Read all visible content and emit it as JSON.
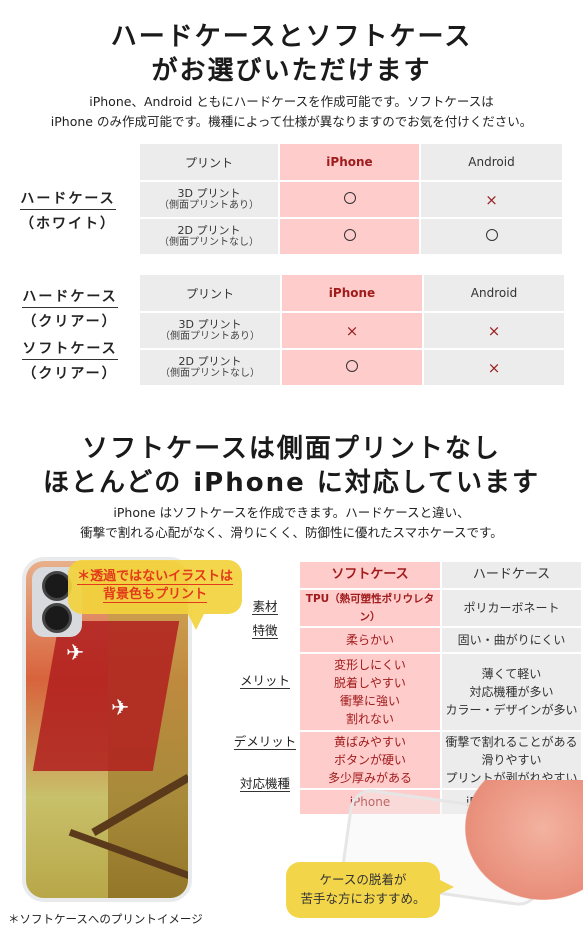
{
  "section1": {
    "title_line1": "ハードケースとソフトケース",
    "title_line2": "がお選びいただけます",
    "sub_line1": "iPhone、Android ともにハードケースを作成可能です。ソフトケースは",
    "sub_line2": "iPhone のみ作成可能です。機種によって仕様が異なりますのでお気を付けください。"
  },
  "table1": {
    "label_main": "ハードケース",
    "label_paren": "（ホワイト）",
    "headers": [
      "プリント",
      "iPhone",
      "Android"
    ],
    "rows": [
      {
        "print": "3D プリント",
        "print_note": "（側面プリントあり）",
        "iphone": "circle",
        "android": "cross"
      },
      {
        "print": "2D プリント",
        "print_note": "（側面プリントなし）",
        "iphone": "circle",
        "android": "circle"
      }
    ]
  },
  "table2": {
    "label1_main": "ハードケース",
    "label1_paren": "（クリアー）",
    "label2_main": "ソフトケース",
    "label2_paren": "（クリアー）",
    "headers": [
      "プリント",
      "iPhone",
      "Android"
    ],
    "rows": [
      {
        "print": "3D プリント",
        "print_note": "（側面プリントあり）",
        "iphone": "cross",
        "android": "cross"
      },
      {
        "print": "2D プリント",
        "print_note": "（側面プリントなし）",
        "iphone": "circle",
        "android": "cross"
      }
    ]
  },
  "marks": {
    "circle": "○",
    "cross": "×"
  },
  "section2": {
    "title_line1": "ソフトケースは側面プリントなし",
    "title_line2": "ほとんどの iPhone に対応しています",
    "sub_line1": "iPhone はソフトケースを作成できます。ハードケースと違い、",
    "sub_line2": "衝撃で割れる心配がなく、滑りにくく、防御性に優れたスマホケースです。"
  },
  "spec": {
    "headers": [
      "ソフトケース",
      "ハードケース"
    ],
    "rows": [
      {
        "label": "素材",
        "soft": [
          "TPU（熱可塑性ポリウレタン）"
        ],
        "hard": [
          "ポリカーボネート"
        ]
      },
      {
        "label": "特徴",
        "soft": [
          "柔らかい"
        ],
        "hard": [
          "固い・曲がりにくい"
        ]
      },
      {
        "label": "メリット",
        "soft": [
          "変形しにくい",
          "脱着しやすい",
          "衝撃に強い",
          "割れない"
        ],
        "hard": [
          "薄くて軽い",
          "対応機種が多い",
          "カラー・デザインが多い"
        ]
      },
      {
        "label": "デメリット",
        "soft": [
          "黄ばみやすい",
          "ボタンが硬い",
          "多少厚みがある"
        ],
        "hard": [
          "衝撃で割れることがある",
          "滑りやすい",
          "プリントが剥がれやすい"
        ]
      },
      {
        "label": "対応機種",
        "soft": [
          "iPhone"
        ],
        "hard": [
          "iPhone/Android"
        ]
      }
    ]
  },
  "bubble_note": {
    "line1": "＊透過ではないイラストは",
    "line2": "背景色もプリント"
  },
  "image_caption": "＊ソフトケースへのプリントイメージ",
  "bubble_recommend": {
    "line1": "ケースの脱着が",
    "line2": "苦手な方におすすめ。"
  },
  "colors": {
    "pink_cell": "#ffcccc",
    "gray_cell": "#ececec",
    "accent_red": "#a01c1c",
    "bubble_yellow": "#f3d54a",
    "note_red": "#e23a1a"
  }
}
